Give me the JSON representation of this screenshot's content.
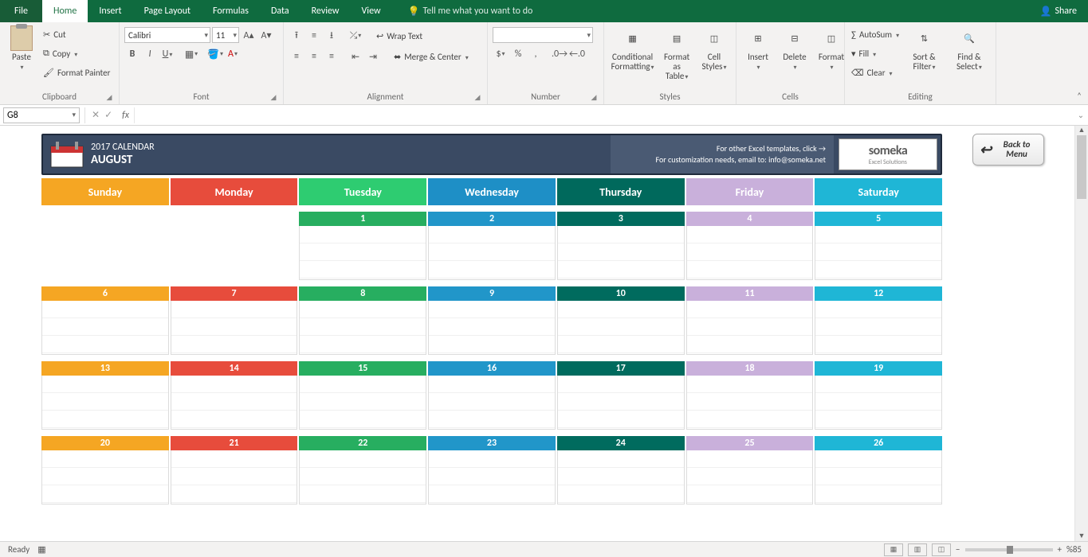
{
  "tabs": {
    "file": "File",
    "home": "Home",
    "insert": "Insert",
    "pageLayout": "Page Layout",
    "formulas": "Formulas",
    "data": "Data",
    "review": "Review",
    "view": "View",
    "tellme": "Tell me what you want to do",
    "share": "Share"
  },
  "ribbon": {
    "clipboard": {
      "paste": "Paste",
      "cut": "Cut",
      "copy": "Copy",
      "formatPainter": "Format Painter",
      "label": "Clipboard"
    },
    "font": {
      "name": "Calibri",
      "size": "11",
      "label": "Font"
    },
    "alignment": {
      "wrap": "Wrap Text",
      "merge": "Merge & Center",
      "label": "Alignment"
    },
    "number": {
      "label": "Number"
    },
    "styles": {
      "cond": "Conditional Formatting",
      "fmtTable": "Format as Table",
      "cellStyles": "Cell Styles",
      "label": "Styles"
    },
    "cells": {
      "insert": "Insert",
      "delete": "Delete",
      "format": "Format",
      "label": "Cells"
    },
    "editing": {
      "autosum": "AutoSum",
      "fill": "Fill",
      "clear": "Clear",
      "sort": "Sort & Filter",
      "find": "Find & Select",
      "label": "Editing"
    }
  },
  "formulaBar": {
    "nameBox": "G8",
    "fx": "fx"
  },
  "calendar": {
    "year": "2017 CALENDAR",
    "month": "AUGUST",
    "note1": "For other Excel templates, click →",
    "note2": "For customization needs, email to: info@someka.net",
    "logo": "someka",
    "logoSub": "Excel Solutions",
    "back": "Back to Menu",
    "days": [
      "Sunday",
      "Monday",
      "Tuesday",
      "Wednesday",
      "Thursday",
      "Friday",
      "Saturday"
    ],
    "weeks": [
      [
        "",
        "",
        "1",
        "2",
        "3",
        "4",
        "5"
      ],
      [
        "6",
        "7",
        "8",
        "9",
        "10",
        "11",
        "12"
      ],
      [
        "13",
        "14",
        "15",
        "16",
        "17",
        "18",
        "19"
      ],
      [
        "20",
        "21",
        "22",
        "23",
        "24",
        "25",
        "26"
      ]
    ]
  },
  "status": {
    "ready": "Ready",
    "zoom": "%85"
  }
}
